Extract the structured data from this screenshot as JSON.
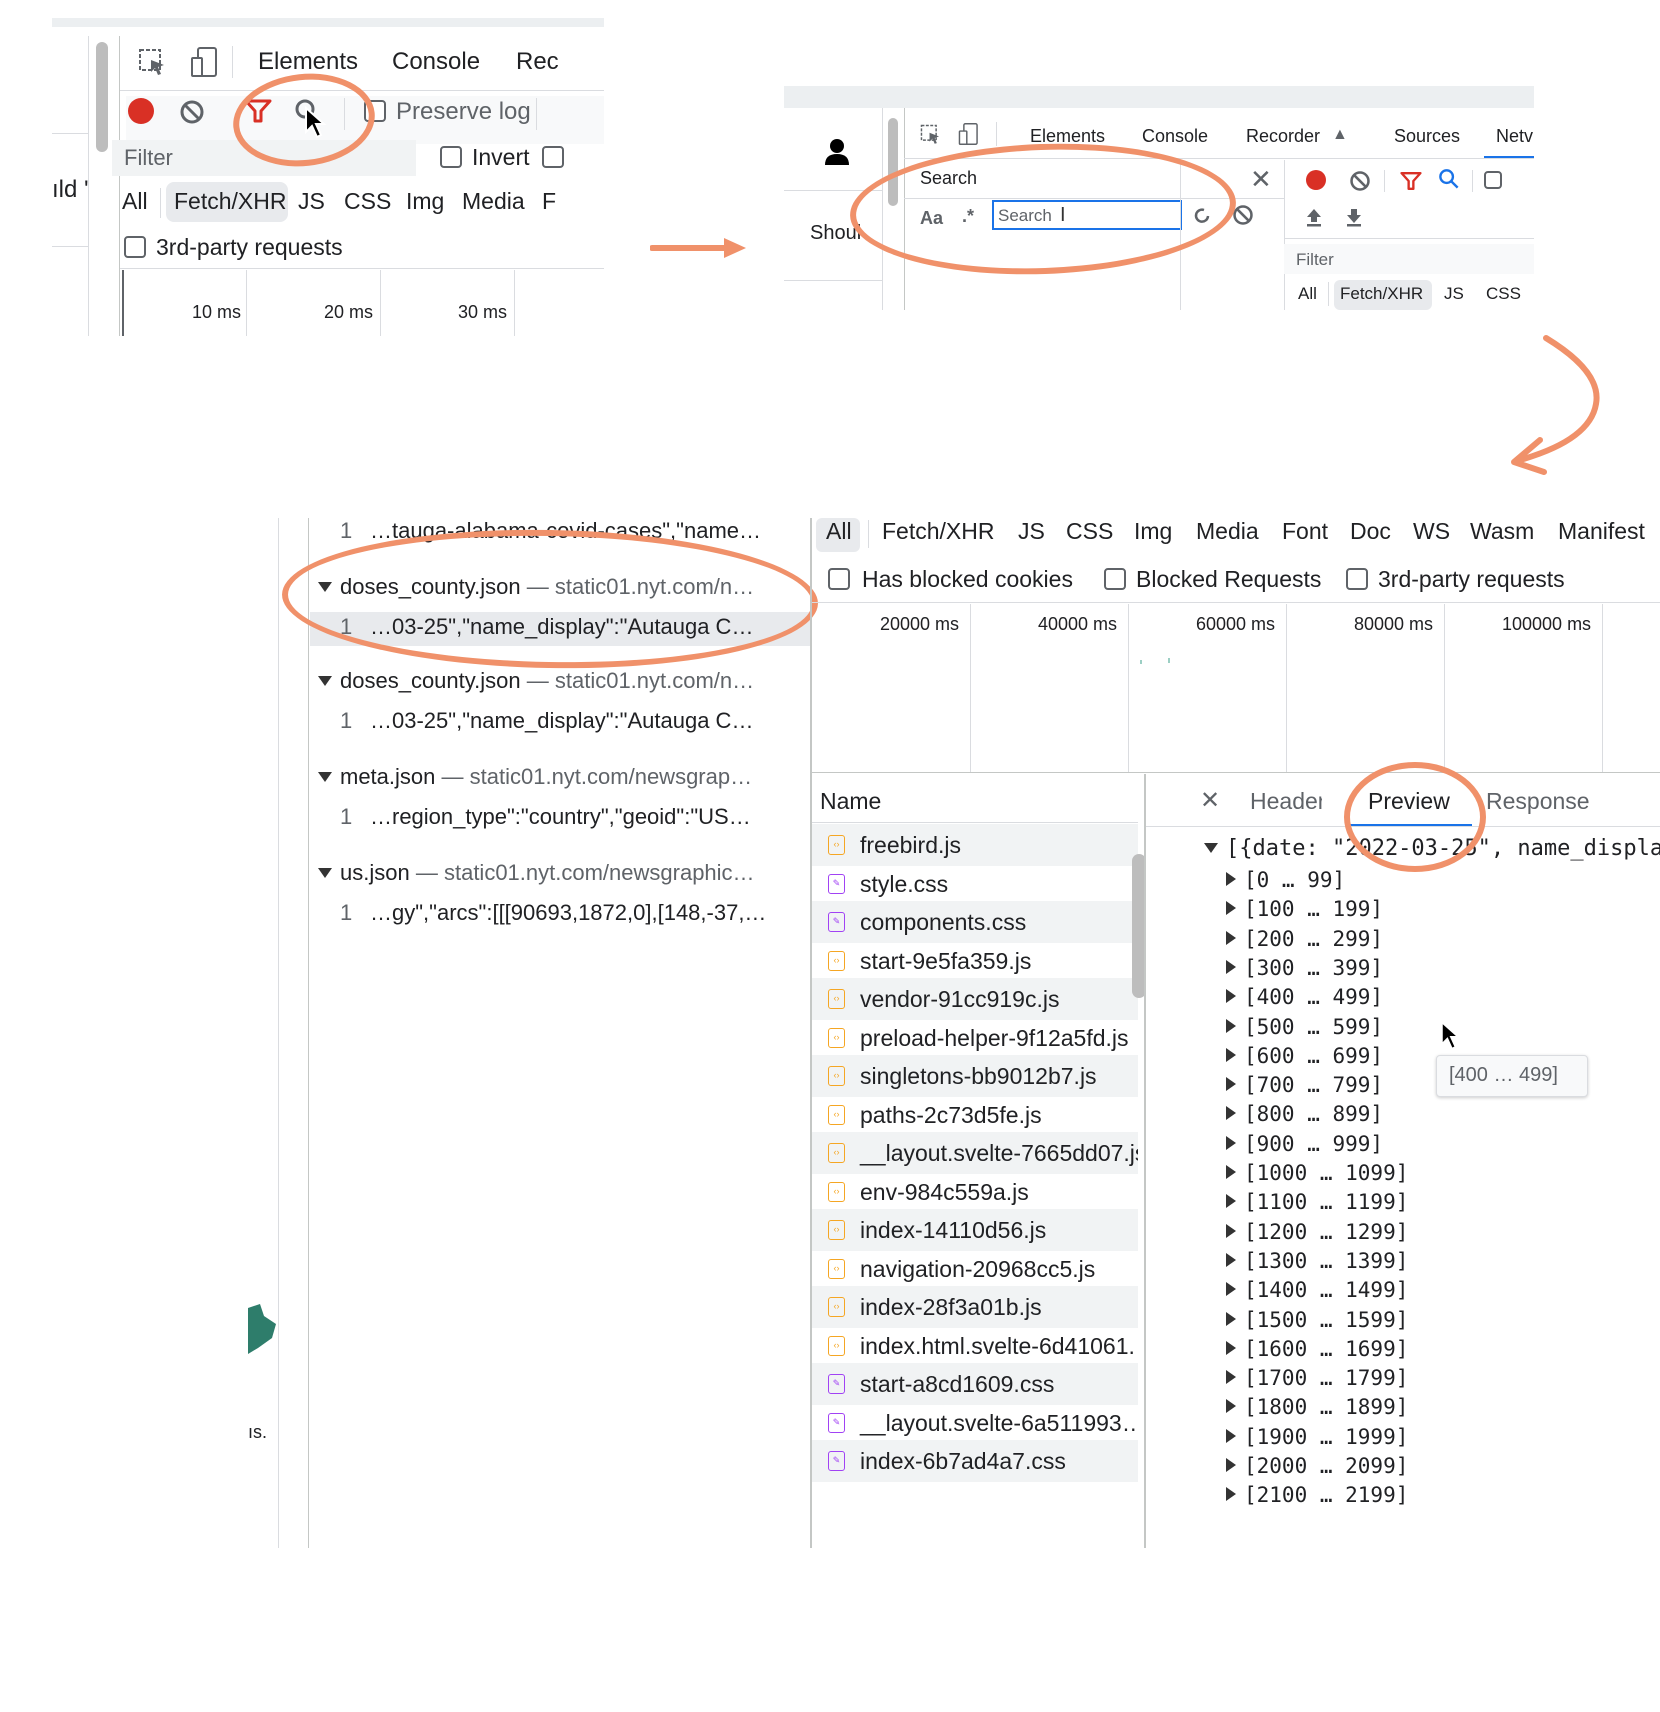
{
  "panel1": {
    "tabs": [
      "Elements",
      "Console",
      "Rec"
    ],
    "preserve_log": "Preserve log",
    "filter_placeholder": "Filter",
    "invert": "Invert",
    "side_text": "ıld '",
    "types": [
      "All",
      "Fetch/XHR",
      "JS",
      "CSS",
      "Img",
      "Media",
      "F"
    ],
    "third_party": "3rd-party requests",
    "timeline": [
      "10 ms",
      "20 ms",
      "30 ms"
    ]
  },
  "panel2": {
    "tabs": [
      "Elements",
      "Console",
      "Recorder",
      "Sources",
      "Netv"
    ],
    "search_title": "Search",
    "match_case": "Aa",
    "regex": ".*",
    "search_placeholder": "Search",
    "left_text": "Shoul",
    "filter_placeholder": "Filter",
    "types": [
      "All",
      "Fetch/XHR",
      "JS",
      "CSS"
    ]
  },
  "panel3": {
    "results": [
      {
        "line": "1",
        "snippet": "…tauga-alabama-covid-cases\",\"name…"
      },
      {
        "file": "doses_county.json",
        "url": "static01.nyt.com/n…",
        "line": "1",
        "snippet": "…03-25\",\"name_display\":\"Autauga C…"
      },
      {
        "file": "doses_county.json",
        "url": "static01.nyt.com/n…",
        "line": "1",
        "snippet": "…03-25\",\"name_display\":\"Autauga C…"
      },
      {
        "file": "meta.json",
        "url": "static01.nyt.com/newsgrap…",
        "line": "1",
        "snippet": "…region_type\":\"country\",\"geoid\":\"US…"
      },
      {
        "file": "us.json",
        "url": "static01.nyt.com/newsgraphic…",
        "line": "1",
        "snippet": "…gy\",\"arcs\":[[[90693,1872,0],[148,-37,…"
      }
    ],
    "page_text": "ıs.",
    "types": [
      "All",
      "Fetch/XHR",
      "JS",
      "CSS",
      "Img",
      "Media",
      "Font",
      "Doc",
      "WS",
      "Wasm",
      "Manifest"
    ],
    "checkboxes": [
      "Has blocked cookies",
      "Blocked Requests",
      "3rd-party requests"
    ],
    "timeline": [
      "20000 ms",
      "40000 ms",
      "60000 ms",
      "80000 ms",
      "100000 ms"
    ],
    "name_header": "Name",
    "files": [
      {
        "name": "freebird.js",
        "kind": "js"
      },
      {
        "name": "style.css",
        "kind": "css"
      },
      {
        "name": "components.css",
        "kind": "css"
      },
      {
        "name": "start-9e5fa359.js",
        "kind": "js"
      },
      {
        "name": "vendor-91cc919c.js",
        "kind": "js"
      },
      {
        "name": "preload-helper-9f12a5fd.js",
        "kind": "js"
      },
      {
        "name": "singletons-bb9012b7.js",
        "kind": "js"
      },
      {
        "name": "paths-2c73d5fe.js",
        "kind": "js"
      },
      {
        "name": "__layout.svelte-7665dd07.js",
        "kind": "js"
      },
      {
        "name": "env-984c559a.js",
        "kind": "js"
      },
      {
        "name": "index-14110d56.js",
        "kind": "js"
      },
      {
        "name": "navigation-20968cc5.js",
        "kind": "js"
      },
      {
        "name": "index-28f3a01b.js",
        "kind": "js"
      },
      {
        "name": "index.html.svelte-6d41061.",
        "kind": "js"
      },
      {
        "name": "start-a8cd1609.css",
        "kind": "css"
      },
      {
        "name": "__layout.svelte-6a511993…",
        "kind": "css"
      },
      {
        "name": "index-6b7ad4a7.css",
        "kind": "css"
      }
    ],
    "detail_tabs": [
      "Headers",
      "Preview",
      "Response"
    ],
    "preview_root": "[{date: \"2022-03-25\", name_displa",
    "ranges": [
      "[0 … 99]",
      "[100 … 199]",
      "[200 … 299]",
      "[300 … 399]",
      "[400 … 499]",
      "[500 … 599]",
      "[600 … 699]",
      "[700 … 799]",
      "[800 … 899]",
      "[900 … 999]",
      "[1000 … 1099]",
      "[1100 … 1199]",
      "[1200 … 1299]",
      "[1300 … 1399]",
      "[1400 … 1499]",
      "[1500 … 1599]",
      "[1600 … 1699]",
      "[1700 … 1799]",
      "[1800 … 1899]",
      "[1900 … 1999]",
      "[2000 … 2099]",
      "[2100 … 2199]"
    ],
    "tooltip": "[400 … 499]"
  },
  "colors": {
    "accent_orange": "#f0916a",
    "record_red": "#d93025",
    "active_blue": "#1a73e8",
    "js_icon": "#f5a623",
    "css_icon": "#a142f4"
  }
}
